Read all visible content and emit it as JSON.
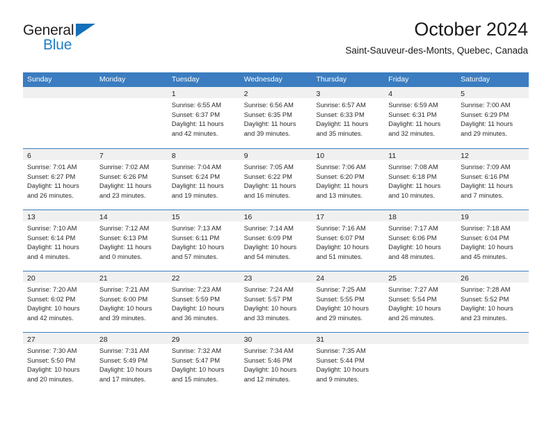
{
  "brand": {
    "name_part1": "General",
    "name_part2": "Blue",
    "triangle_icon": "triangle-icon",
    "color_dark": "#231f20",
    "color_blue": "#1f7ec4"
  },
  "header": {
    "title": "October 2024",
    "subtitle": "Saint-Sauveur-des-Monts, Quebec, Canada"
  },
  "theme": {
    "header_blue": "#3b7dc0",
    "day_band_gray": "#f0f0f0",
    "text": "#2b2b2b"
  },
  "calendar": {
    "weekdays": [
      "Sunday",
      "Monday",
      "Tuesday",
      "Wednesday",
      "Thursday",
      "Friday",
      "Saturday"
    ],
    "weeks": [
      [
        {
          "day": "",
          "lines": []
        },
        {
          "day": "",
          "lines": []
        },
        {
          "day": "1",
          "lines": [
            "Sunrise: 6:55 AM",
            "Sunset: 6:37 PM",
            "Daylight: 11 hours",
            "and 42 minutes."
          ]
        },
        {
          "day": "2",
          "lines": [
            "Sunrise: 6:56 AM",
            "Sunset: 6:35 PM",
            "Daylight: 11 hours",
            "and 39 minutes."
          ]
        },
        {
          "day": "3",
          "lines": [
            "Sunrise: 6:57 AM",
            "Sunset: 6:33 PM",
            "Daylight: 11 hours",
            "and 35 minutes."
          ]
        },
        {
          "day": "4",
          "lines": [
            "Sunrise: 6:59 AM",
            "Sunset: 6:31 PM",
            "Daylight: 11 hours",
            "and 32 minutes."
          ]
        },
        {
          "day": "5",
          "lines": [
            "Sunrise: 7:00 AM",
            "Sunset: 6:29 PM",
            "Daylight: 11 hours",
            "and 29 minutes."
          ]
        }
      ],
      [
        {
          "day": "6",
          "lines": [
            "Sunrise: 7:01 AM",
            "Sunset: 6:27 PM",
            "Daylight: 11 hours",
            "and 26 minutes."
          ]
        },
        {
          "day": "7",
          "lines": [
            "Sunrise: 7:02 AM",
            "Sunset: 6:26 PM",
            "Daylight: 11 hours",
            "and 23 minutes."
          ]
        },
        {
          "day": "8",
          "lines": [
            "Sunrise: 7:04 AM",
            "Sunset: 6:24 PM",
            "Daylight: 11 hours",
            "and 19 minutes."
          ]
        },
        {
          "day": "9",
          "lines": [
            "Sunrise: 7:05 AM",
            "Sunset: 6:22 PM",
            "Daylight: 11 hours",
            "and 16 minutes."
          ]
        },
        {
          "day": "10",
          "lines": [
            "Sunrise: 7:06 AM",
            "Sunset: 6:20 PM",
            "Daylight: 11 hours",
            "and 13 minutes."
          ]
        },
        {
          "day": "11",
          "lines": [
            "Sunrise: 7:08 AM",
            "Sunset: 6:18 PM",
            "Daylight: 11 hours",
            "and 10 minutes."
          ]
        },
        {
          "day": "12",
          "lines": [
            "Sunrise: 7:09 AM",
            "Sunset: 6:16 PM",
            "Daylight: 11 hours",
            "and 7 minutes."
          ]
        }
      ],
      [
        {
          "day": "13",
          "lines": [
            "Sunrise: 7:10 AM",
            "Sunset: 6:14 PM",
            "Daylight: 11 hours",
            "and 4 minutes."
          ]
        },
        {
          "day": "14",
          "lines": [
            "Sunrise: 7:12 AM",
            "Sunset: 6:13 PM",
            "Daylight: 11 hours",
            "and 0 minutes."
          ]
        },
        {
          "day": "15",
          "lines": [
            "Sunrise: 7:13 AM",
            "Sunset: 6:11 PM",
            "Daylight: 10 hours",
            "and 57 minutes."
          ]
        },
        {
          "day": "16",
          "lines": [
            "Sunrise: 7:14 AM",
            "Sunset: 6:09 PM",
            "Daylight: 10 hours",
            "and 54 minutes."
          ]
        },
        {
          "day": "17",
          "lines": [
            "Sunrise: 7:16 AM",
            "Sunset: 6:07 PM",
            "Daylight: 10 hours",
            "and 51 minutes."
          ]
        },
        {
          "day": "18",
          "lines": [
            "Sunrise: 7:17 AM",
            "Sunset: 6:06 PM",
            "Daylight: 10 hours",
            "and 48 minutes."
          ]
        },
        {
          "day": "19",
          "lines": [
            "Sunrise: 7:18 AM",
            "Sunset: 6:04 PM",
            "Daylight: 10 hours",
            "and 45 minutes."
          ]
        }
      ],
      [
        {
          "day": "20",
          "lines": [
            "Sunrise: 7:20 AM",
            "Sunset: 6:02 PM",
            "Daylight: 10 hours",
            "and 42 minutes."
          ]
        },
        {
          "day": "21",
          "lines": [
            "Sunrise: 7:21 AM",
            "Sunset: 6:00 PM",
            "Daylight: 10 hours",
            "and 39 minutes."
          ]
        },
        {
          "day": "22",
          "lines": [
            "Sunrise: 7:23 AM",
            "Sunset: 5:59 PM",
            "Daylight: 10 hours",
            "and 36 minutes."
          ]
        },
        {
          "day": "23",
          "lines": [
            "Sunrise: 7:24 AM",
            "Sunset: 5:57 PM",
            "Daylight: 10 hours",
            "and 33 minutes."
          ]
        },
        {
          "day": "24",
          "lines": [
            "Sunrise: 7:25 AM",
            "Sunset: 5:55 PM",
            "Daylight: 10 hours",
            "and 29 minutes."
          ]
        },
        {
          "day": "25",
          "lines": [
            "Sunrise: 7:27 AM",
            "Sunset: 5:54 PM",
            "Daylight: 10 hours",
            "and 26 minutes."
          ]
        },
        {
          "day": "26",
          "lines": [
            "Sunrise: 7:28 AM",
            "Sunset: 5:52 PM",
            "Daylight: 10 hours",
            "and 23 minutes."
          ]
        }
      ],
      [
        {
          "day": "27",
          "lines": [
            "Sunrise: 7:30 AM",
            "Sunset: 5:50 PM",
            "Daylight: 10 hours",
            "and 20 minutes."
          ]
        },
        {
          "day": "28",
          "lines": [
            "Sunrise: 7:31 AM",
            "Sunset: 5:49 PM",
            "Daylight: 10 hours",
            "and 17 minutes."
          ]
        },
        {
          "day": "29",
          "lines": [
            "Sunrise: 7:32 AM",
            "Sunset: 5:47 PM",
            "Daylight: 10 hours",
            "and 15 minutes."
          ]
        },
        {
          "day": "30",
          "lines": [
            "Sunrise: 7:34 AM",
            "Sunset: 5:46 PM",
            "Daylight: 10 hours",
            "and 12 minutes."
          ]
        },
        {
          "day": "31",
          "lines": [
            "Sunrise: 7:35 AM",
            "Sunset: 5:44 PM",
            "Daylight: 10 hours",
            "and 9 minutes."
          ]
        },
        {
          "day": "",
          "lines": []
        },
        {
          "day": "",
          "lines": []
        }
      ]
    ]
  }
}
